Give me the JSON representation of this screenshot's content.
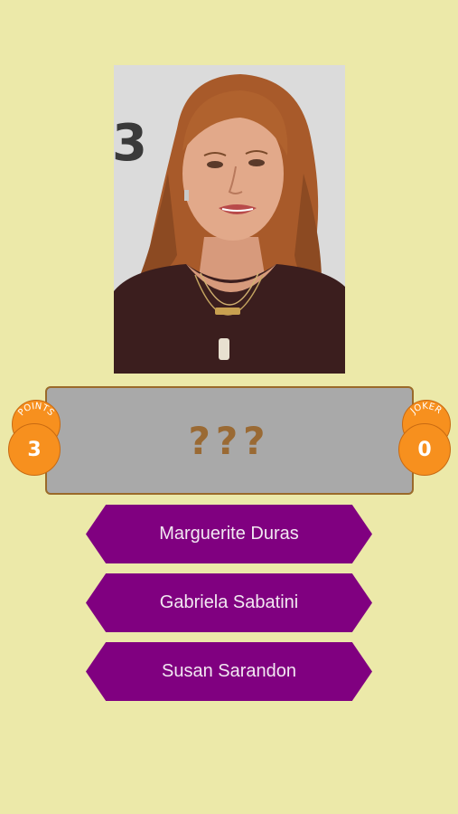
{
  "question": {
    "mystery_text": "???"
  },
  "points": {
    "label": "POINTS",
    "value": "3"
  },
  "joker": {
    "label": "JOKER",
    "value": "0"
  },
  "answers": [
    {
      "label": "Marguerite Duras"
    },
    {
      "label": "Gabriela Sabatini"
    },
    {
      "label": "Susan Sarandon"
    }
  ],
  "colors": {
    "background": "#ece9a9",
    "answer_button": "#800080",
    "badge": "#f7901e",
    "question_panel": "#a9a9a9",
    "question_text": "#9a6a34"
  }
}
